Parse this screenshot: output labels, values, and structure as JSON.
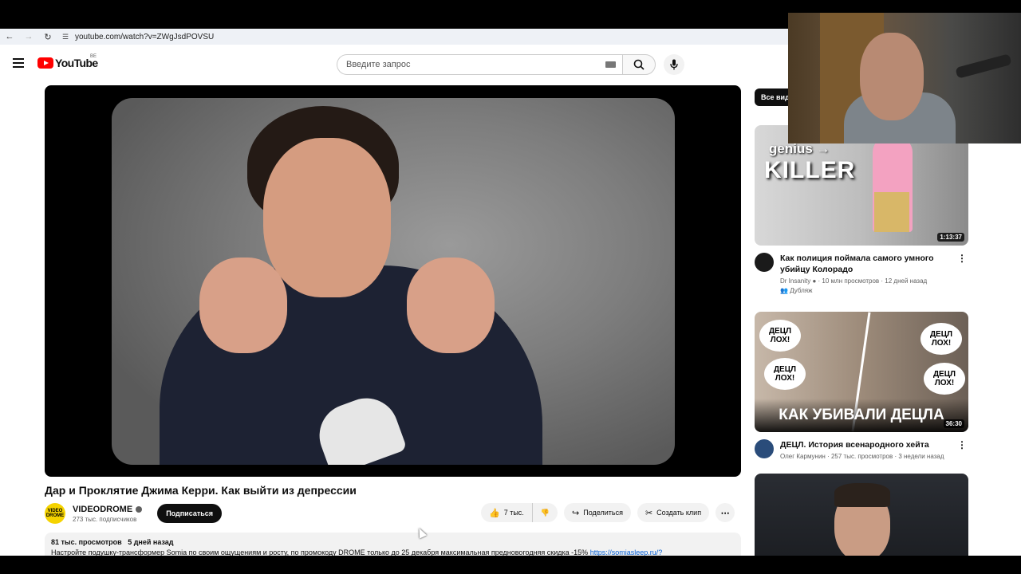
{
  "browser": {
    "url": "youtube.com/watch?v=ZWgJsdPOVSU"
  },
  "header": {
    "logo_text": "YouTube",
    "region": "BE",
    "search_placeholder": "Введите запрос"
  },
  "video": {
    "title": "Дар и Проклятие Джима Керри. Как выйти из депрессии",
    "channel": {
      "name": "VIDEODROME",
      "subscribers": "273 тыс. подписчиков",
      "avatar_text": "VIDEO DROME"
    },
    "subscribe_label": "Подписаться",
    "likes": "7 тыс.",
    "share_label": "Поделиться",
    "clip_label": "Создать клип",
    "views": "81 тыс. просмотров",
    "date": "5 дней назад",
    "description": "Настройте подушку-трансформер Somia по своим ощущениям и росту, по промокоду DROME только до 25 декабря максимальная предновогодняя скидка -15%",
    "description_link": "https://somiasleep.ru/?"
  },
  "sidebar": {
    "chip_label": "Все вид",
    "recommendations": [
      {
        "title": "Как полиция поймала самого умного убийцу Колорадо",
        "channel": "Dr Insanity",
        "views": "10 млн просмотров",
        "date": "12 дней назад",
        "badge": "Дубляж",
        "duration": "1:13:37",
        "thumb_text_1": "genius →",
        "thumb_text_2": "KILLER",
        "avatar_color": "#1a1a1a"
      },
      {
        "title": "ДЕЦЛ. История всенародного хейта",
        "channel": "Олег Кармунин",
        "views": "257 тыс. просмотров",
        "date": "3 недели назад",
        "duration": "36:30",
        "thumb_text": "КАК УБИВАЛИ ДЕЦЛА",
        "bubble_text": "ДЕЦЛ ЛОХ!",
        "avatar_color": "#2a4c7a"
      }
    ]
  }
}
